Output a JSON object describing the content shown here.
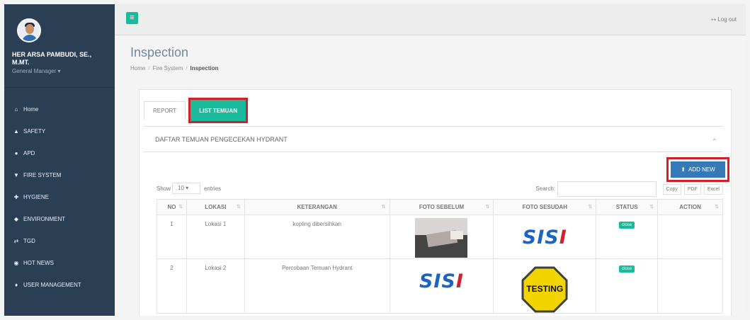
{
  "user": {
    "name": "HER ARSA PAMBUDI, SE., M.MT.",
    "role": "General Manager ▾"
  },
  "sidebar": {
    "items": [
      {
        "icon": "home-icon",
        "glyph": "⌂",
        "label": "Home"
      },
      {
        "icon": "safety-icon",
        "glyph": "▲",
        "label": "SAFETY"
      },
      {
        "icon": "apd-icon",
        "glyph": "●",
        "label": "APD"
      },
      {
        "icon": "fire-system-icon",
        "glyph": "▼",
        "label": "FIRE SYSTEM"
      },
      {
        "icon": "hygiene-icon",
        "glyph": "✚",
        "label": "HYGIENE"
      },
      {
        "icon": "environment-icon",
        "glyph": "◆",
        "label": "ENVIRONMENT"
      },
      {
        "icon": "tgd-icon",
        "glyph": "⇄",
        "label": "TGD"
      },
      {
        "icon": "hot-news-icon",
        "glyph": "◉",
        "label": "HOT NEWS"
      },
      {
        "icon": "user-management-icon",
        "glyph": "♦",
        "label": "USER MANAGEMENT"
      }
    ]
  },
  "header": {
    "logout": "Log out"
  },
  "page": {
    "title": "Inspection",
    "breadcrumb": [
      "Home",
      "Fire System",
      "Inspection"
    ]
  },
  "tabs": [
    {
      "label": "REPORT"
    },
    {
      "label": "LIST TEMUAN"
    }
  ],
  "section": {
    "title": "DAFTAR TEMUAN PENGECEKAN HYDRANT"
  },
  "add_new_label": "ADD NEW",
  "table_controls": {
    "show": "Show",
    "entries_value": "10",
    "entries": "entries",
    "search": "Search:",
    "exports": [
      "Copy",
      "PDF",
      "Excel"
    ]
  },
  "table": {
    "headers": [
      "NO",
      "LOKASI",
      "KETERANGAN",
      "FOTO SEBELUM",
      "FOTO SESUDAH",
      "STATUS",
      "ACTION"
    ],
    "rows": [
      {
        "no": "1",
        "lokasi": "Lokasi 1",
        "keterangan": "kopling dibersihkan",
        "status": "close"
      },
      {
        "no": "2",
        "lokasi": "Lokasi 2",
        "keterangan": "Percobaan Temuan Hydrant",
        "status": "close"
      }
    ]
  },
  "logo": {
    "primary": "SIS",
    "accent": "I"
  },
  "testing_sign": "TESTING",
  "colors": {
    "accent": "#1abb9c",
    "sidebar": "#2a3f54",
    "primary": "#337ab7",
    "highlight": "#d51f27"
  }
}
